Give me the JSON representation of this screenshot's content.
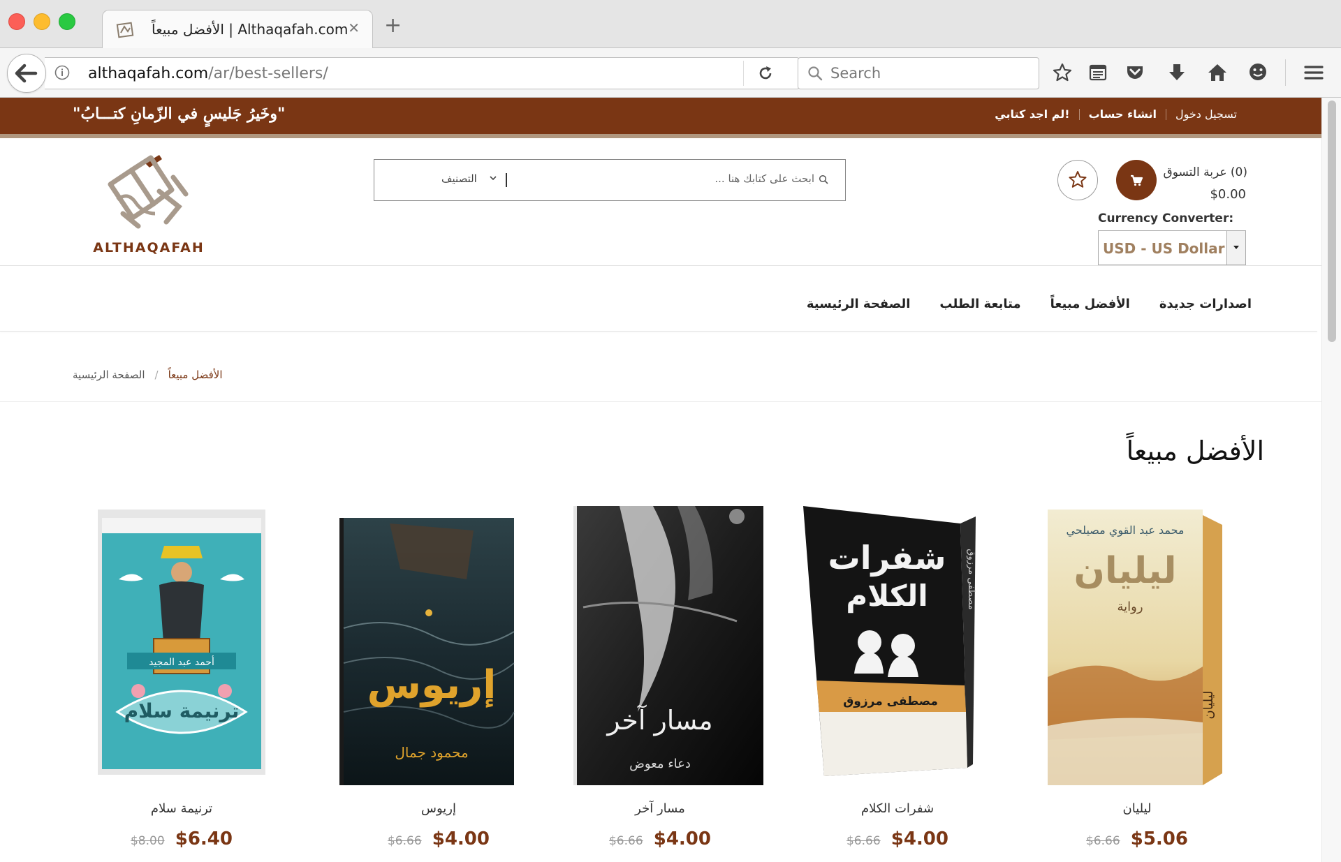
{
  "browser": {
    "tab_title": "الأفضل مبيعاً | Althaqafah.com",
    "url_host": "althaqafah.com",
    "url_path": "/ar/best-sellers/",
    "search_placeholder": "Search"
  },
  "topbar": {
    "slogan": "\"وخَيرُ جَليسٍ في الزّمانِ كتـــابُ\"",
    "links": [
      "تسجيل دخول",
      "انشاء حساب",
      "لم اجد كتابي!"
    ]
  },
  "header": {
    "logo_text": "ALTHAQAFAH",
    "search_placeholder": "ابحث على كتابك هنا ...",
    "category_label": "التصنيف",
    "cart_label": "عربة التسوق",
    "cart_count": "(0)",
    "cart_total": "$0.00",
    "currency_label": "Currency Converter:",
    "currency_value": "USD - US Dollar"
  },
  "nav": {
    "items": [
      "الصفحة الرئيسية",
      "متابعة الطلب",
      "الأفضل مبيعاً",
      "اصدارات جديدة"
    ]
  },
  "breadcrumb": {
    "home": "الصفحة الرئيسية",
    "separator": "/",
    "current": "الأفضل مبيعاً"
  },
  "page": {
    "title": "الأفضل مبيعاً"
  },
  "products": [
    {
      "title": "ليليان",
      "old_price": "$6.66",
      "new_price": "$5.06",
      "cover": {
        "title": "ليليان",
        "author": "محمد عبد القوي مصيلحي",
        "subtitle": "رواية",
        "spine": "ليليان"
      }
    },
    {
      "title": "شفرات الكلام",
      "old_price": "$6.66",
      "new_price": "$4.00",
      "cover": {
        "title_line1": "شفرات",
        "title_line2": "الكلام",
        "author": "مصطفى مرزوق",
        "spine": "مصطفى مرزوق"
      }
    },
    {
      "title": "مسار آخر",
      "old_price": "$6.66",
      "new_price": "$4.00",
      "cover": {
        "title": "مسار آخر",
        "author": "دعاء معوض"
      }
    },
    {
      "title": "إريوس",
      "old_price": "$6.66",
      "new_price": "$4.00",
      "cover": {
        "title": "إريوس",
        "author": "محمود جمال"
      }
    },
    {
      "title": "ترنيمة سلام",
      "old_price": "$8.00",
      "new_price": "$6.40",
      "cover": {
        "title": "ترنيمة سلام",
        "author": "أحمد عبد المجيد"
      }
    }
  ],
  "colors": {
    "brand": "#7a3614",
    "topbar_border": "#b0977f",
    "price": "#7a3614"
  }
}
